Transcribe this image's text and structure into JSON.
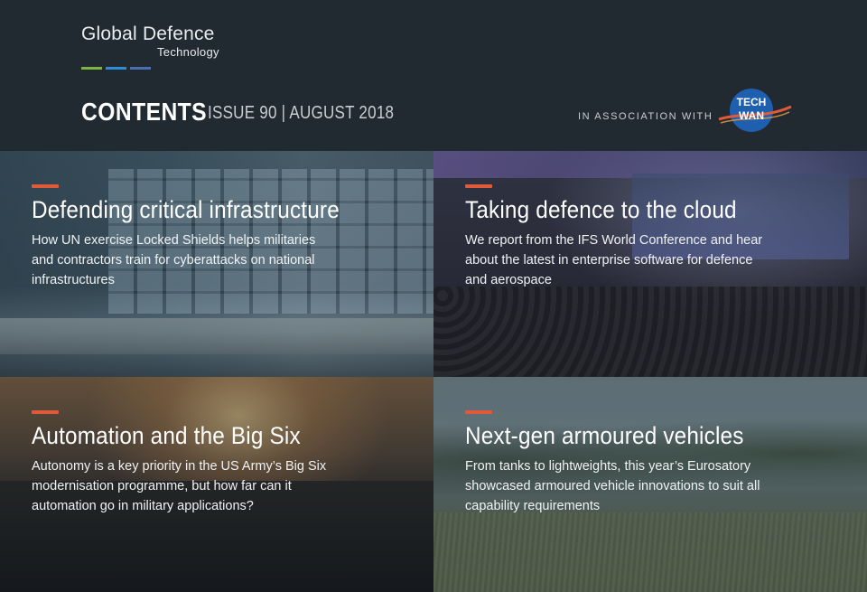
{
  "brand": {
    "logo_line1": "Global Defence",
    "logo_line2": "Technology",
    "bar_colors": [
      "#7cb342",
      "#2e8bd6",
      "#4a6fb0"
    ],
    "partner_name": "TECH WAN"
  },
  "header": {
    "title": "CONTENTS",
    "issue": "ISSUE 90 | AUGUST 2018",
    "association_label": "IN ASSOCIATION WITH"
  },
  "colors": {
    "background": "#222a31",
    "accent": "#e05a3a"
  },
  "articles": [
    {
      "title": "Defending critical infrastructure",
      "description": "How UN exercise Locked Shields helps militaries and contractors train for cyberattacks on national infrastructures"
    },
    {
      "title": "Taking defence to the cloud",
      "description": "We report from the IFS World Conference and hear about the latest in enterprise software for defence and aerospace"
    },
    {
      "title": "Automation and the Big Six",
      "description": "Autonomy is a key priority in the US Army’s Big Six modernisation programme, but how far can it automation go in military applications?"
    },
    {
      "title": "Next-gen armoured vehicles",
      "description": "From tanks to lightweights, this year’s Eurosatory showcased armoured vehicle innovations to suit all capability requirements"
    }
  ]
}
